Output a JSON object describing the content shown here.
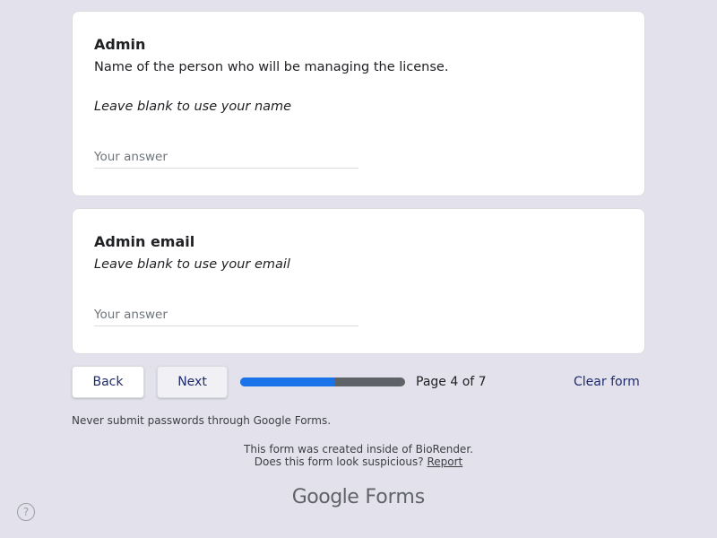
{
  "questions": [
    {
      "title": "Admin",
      "description": "Name of the person who will be managing the license.",
      "note": "Leave blank to use your name",
      "placeholder": "Your answer",
      "value": ""
    },
    {
      "title": "Admin email",
      "note": "Leave blank to use your email",
      "placeholder": "Your answer",
      "value": ""
    }
  ],
  "navigation": {
    "back_label": "Back",
    "next_label": "Next",
    "page_label": "Page 4 of 7",
    "progress_fraction": 0.57,
    "clear_label": "Clear form"
  },
  "footer": {
    "password_notice": "Never submit passwords through Google Forms.",
    "created_inside": "This form was created inside of BioRender.",
    "suspicious_prompt": "Does this form look suspicious?",
    "report_label": "Report",
    "brand_google": "Google",
    "brand_forms": "Forms"
  },
  "help": {
    "icon": "help-circle-icon",
    "glyph": "?"
  },
  "colors": {
    "background": "#e3e2ec",
    "progress_fill": "#1a73e8",
    "progress_track": "#5f6368",
    "button_text": "#1f2a6b"
  }
}
